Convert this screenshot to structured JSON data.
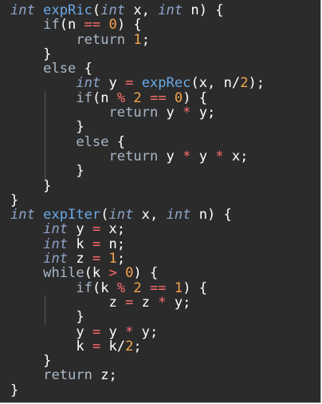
{
  "editor": {
    "background": "#2b2b2b",
    "colors": {
      "keyword": "#a9b7c6",
      "type": "#8ea4c9",
      "function": "#6aa9e6",
      "operator": "#ff6e6e",
      "number": "#f5a54c",
      "identifier": "#ffffff"
    },
    "lines": [
      [
        {
          "t": "ty",
          "v": "int"
        },
        {
          "t": "id",
          "v": " "
        },
        {
          "t": "fn",
          "v": "expRic"
        },
        {
          "t": "pu",
          "v": "("
        },
        {
          "t": "ty",
          "v": "int"
        },
        {
          "t": "id",
          "v": " x, "
        },
        {
          "t": "ty",
          "v": "int"
        },
        {
          "t": "id",
          "v": " n) {"
        }
      ],
      [
        {
          "t": "id",
          "v": "    "
        },
        {
          "t": "kw",
          "v": "if"
        },
        {
          "t": "pu",
          "v": "(n "
        },
        {
          "t": "op",
          "v": "=="
        },
        {
          "t": "id",
          "v": " "
        },
        {
          "t": "num",
          "v": "0"
        },
        {
          "t": "pu",
          "v": ") {"
        }
      ],
      [
        {
          "t": "id",
          "v": "        "
        },
        {
          "t": "kw",
          "v": "return"
        },
        {
          "t": "id",
          "v": " "
        },
        {
          "t": "num",
          "v": "1"
        },
        {
          "t": "pu",
          "v": ";"
        }
      ],
      [
        {
          "t": "pu",
          "v": "    }"
        }
      ],
      [
        {
          "t": "id",
          "v": "    "
        },
        {
          "t": "kw",
          "v": "else"
        },
        {
          "t": "pu",
          "v": " {"
        }
      ],
      [
        {
          "t": "id",
          "v": "        "
        },
        {
          "t": "ty",
          "v": "int"
        },
        {
          "t": "id",
          "v": " y "
        },
        {
          "t": "op",
          "v": "="
        },
        {
          "t": "id",
          "v": " "
        },
        {
          "t": "fn",
          "v": "expRec"
        },
        {
          "t": "pu",
          "v": "(x, n/"
        },
        {
          "t": "num",
          "v": "2"
        },
        {
          "t": "pu",
          "v": ");"
        }
      ],
      [
        {
          "t": "id",
          "v": "        "
        },
        {
          "t": "kw",
          "v": "if"
        },
        {
          "t": "pu",
          "v": "(n "
        },
        {
          "t": "op",
          "v": "%"
        },
        {
          "t": "id",
          "v": " "
        },
        {
          "t": "num",
          "v": "2"
        },
        {
          "t": "id",
          "v": " "
        },
        {
          "t": "op",
          "v": "=="
        },
        {
          "t": "id",
          "v": " "
        },
        {
          "t": "num",
          "v": "0"
        },
        {
          "t": "pu",
          "v": ") {"
        }
      ],
      [
        {
          "t": "id",
          "v": "            "
        },
        {
          "t": "kw",
          "v": "return"
        },
        {
          "t": "id",
          "v": " y "
        },
        {
          "t": "op",
          "v": "*"
        },
        {
          "t": "id",
          "v": " y;"
        }
      ],
      [
        {
          "t": "pu",
          "v": "        }"
        }
      ],
      [
        {
          "t": "id",
          "v": "        "
        },
        {
          "t": "kw",
          "v": "else"
        },
        {
          "t": "pu",
          "v": " {"
        }
      ],
      [
        {
          "t": "id",
          "v": "            "
        },
        {
          "t": "kw",
          "v": "return"
        },
        {
          "t": "id",
          "v": " y "
        },
        {
          "t": "op",
          "v": "*"
        },
        {
          "t": "id",
          "v": " y "
        },
        {
          "t": "op",
          "v": "*"
        },
        {
          "t": "id",
          "v": " x;"
        }
      ],
      [
        {
          "t": "pu",
          "v": "        }"
        }
      ],
      [
        {
          "t": "pu",
          "v": "    }"
        }
      ],
      [
        {
          "t": "pu",
          "v": "}"
        }
      ],
      [
        {
          "t": "ty",
          "v": "int"
        },
        {
          "t": "id",
          "v": " "
        },
        {
          "t": "fn",
          "v": "expIter"
        },
        {
          "t": "pu",
          "v": "("
        },
        {
          "t": "ty",
          "v": "int"
        },
        {
          "t": "id",
          "v": " x, "
        },
        {
          "t": "ty",
          "v": "int"
        },
        {
          "t": "id",
          "v": " n) {"
        }
      ],
      [
        {
          "t": "id",
          "v": "    "
        },
        {
          "t": "ty",
          "v": "int"
        },
        {
          "t": "id",
          "v": " y "
        },
        {
          "t": "op",
          "v": "="
        },
        {
          "t": "id",
          "v": " x;"
        }
      ],
      [
        {
          "t": "id",
          "v": "    "
        },
        {
          "t": "ty",
          "v": "int"
        },
        {
          "t": "id",
          "v": " k "
        },
        {
          "t": "op",
          "v": "="
        },
        {
          "t": "id",
          "v": " n;"
        }
      ],
      [
        {
          "t": "id",
          "v": "    "
        },
        {
          "t": "ty",
          "v": "int"
        },
        {
          "t": "id",
          "v": " z "
        },
        {
          "t": "op",
          "v": "="
        },
        {
          "t": "id",
          "v": " "
        },
        {
          "t": "num",
          "v": "1"
        },
        {
          "t": "pu",
          "v": ";"
        }
      ],
      [
        {
          "t": "id",
          "v": "    "
        },
        {
          "t": "kw",
          "v": "while"
        },
        {
          "t": "pu",
          "v": "(k "
        },
        {
          "t": "op",
          "v": ">"
        },
        {
          "t": "id",
          "v": " "
        },
        {
          "t": "num",
          "v": "0"
        },
        {
          "t": "pu",
          "v": ") {"
        }
      ],
      [
        {
          "t": "id",
          "v": "        "
        },
        {
          "t": "kw",
          "v": "if"
        },
        {
          "t": "pu",
          "v": "(k "
        },
        {
          "t": "op",
          "v": "%"
        },
        {
          "t": "id",
          "v": " "
        },
        {
          "t": "num",
          "v": "2"
        },
        {
          "t": "id",
          "v": " "
        },
        {
          "t": "op",
          "v": "=="
        },
        {
          "t": "id",
          "v": " "
        },
        {
          "t": "num",
          "v": "1"
        },
        {
          "t": "pu",
          "v": ") {"
        }
      ],
      [
        {
          "t": "id",
          "v": "            z "
        },
        {
          "t": "op",
          "v": "="
        },
        {
          "t": "id",
          "v": " z "
        },
        {
          "t": "op",
          "v": "*"
        },
        {
          "t": "id",
          "v": " y;"
        }
      ],
      [
        {
          "t": "pu",
          "v": "        }"
        }
      ],
      [
        {
          "t": "id",
          "v": "        y "
        },
        {
          "t": "op",
          "v": "="
        },
        {
          "t": "id",
          "v": " y "
        },
        {
          "t": "op",
          "v": "*"
        },
        {
          "t": "id",
          "v": " y;"
        }
      ],
      [
        {
          "t": "id",
          "v": "        k "
        },
        {
          "t": "op",
          "v": "="
        },
        {
          "t": "id",
          "v": " k/"
        },
        {
          "t": "num",
          "v": "2"
        },
        {
          "t": "pu",
          "v": ";"
        }
      ],
      [
        {
          "t": "pu",
          "v": "    }"
        }
      ],
      [
        {
          "t": "id",
          "v": "    "
        },
        {
          "t": "kw",
          "v": "return"
        },
        {
          "t": "id",
          "v": " z;"
        }
      ],
      [
        {
          "t": "pu",
          "v": "}"
        }
      ]
    ]
  }
}
